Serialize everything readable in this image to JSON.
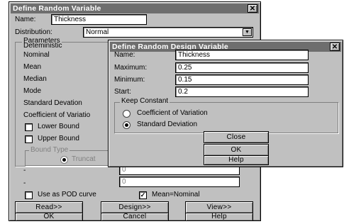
{
  "main_window": {
    "title": "Define Random Variable",
    "name_label": "Name:",
    "name_value": "Thickness",
    "distribution_label": "Distribution:",
    "distribution_value": "Normal",
    "parameters_label": "Parameters",
    "param_mode": "Deteministic",
    "params": [
      "Nominal",
      "Mean",
      "Median",
      "Mode",
      "Standard Devation",
      "Coefficient of Variatio"
    ],
    "lower_bound_label": "Lower Bound",
    "upper_bound_label": "Upper Bound",
    "bound_type_label": "Bound Type",
    "truncated_label": "Truncat",
    "lower_field_value": "0",
    "upper_field_value": "0",
    "pod_curve_label": "Use as POD curve",
    "mean_nominal_label": "Mean=Nominal",
    "mean_nominal_checked": "✓",
    "buttons": {
      "read": "Read>>",
      "design": "Design>>",
      "view": "View>>",
      "ok": "OK",
      "cancel": "Cancel",
      "help": "Help"
    }
  },
  "design_dialog": {
    "title": "Define Random Design Variable",
    "name_label": "Name:",
    "name_value": "Thickness",
    "maximum_label": "Maximum:",
    "maximum_value": "0.25",
    "minimum_label": "Minimum:",
    "minimum_value": "0.15",
    "start_label": "Start:",
    "start_value": "0.2",
    "keep_constant_label": "Keep Constant",
    "option_cov": "Coefficient of Variation",
    "option_sd": "Standard Deviation",
    "selected_option": "Standard Deviation",
    "buttons": {
      "close": "Close",
      "ok": "OK",
      "help": "Help"
    }
  },
  "close_glyph": "✕"
}
